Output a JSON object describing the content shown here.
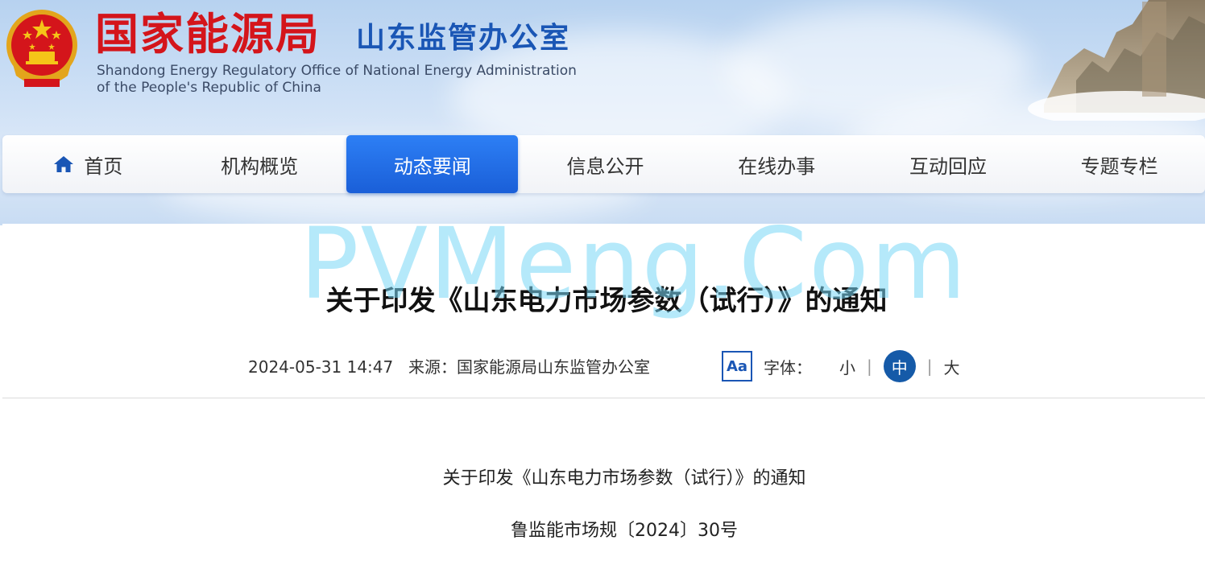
{
  "header": {
    "title_cn": "国家能源局",
    "subtitle_cn": "山东监管办公室",
    "title_en_line1": "Shandong Energy Regulatory Office of National Energy Administration",
    "title_en_line2": "of the People's Republic of China",
    "emblem_icon": "national-emblem-icon",
    "brand_red": "#d4151b",
    "brand_blue": "#1a56b5"
  },
  "nav": {
    "items": [
      {
        "label": "首页",
        "icon": "home-icon"
      },
      {
        "label": "机构概览"
      },
      {
        "label": "动态要闻",
        "active": true
      },
      {
        "label": "信息公开"
      },
      {
        "label": "在线办事"
      },
      {
        "label": "互动回应"
      },
      {
        "label": "专题专栏"
      }
    ],
    "active_color": "#1a5fd8"
  },
  "watermark": "PVMeng.Com",
  "article": {
    "title": "关于印发《山东电力市场参数（试行）》的通知",
    "date": "2024-05-31 14:47",
    "source": "来源：国家能源局山东监管办公室",
    "font_control": {
      "icon_label": "Aa",
      "label": "字体：",
      "options": [
        "小",
        "中",
        "大"
      ],
      "selected": "中"
    },
    "body": [
      "关于印发《山东电力市场参数（试行）》的通知",
      "鲁监能市场规〔2024〕30号"
    ]
  }
}
